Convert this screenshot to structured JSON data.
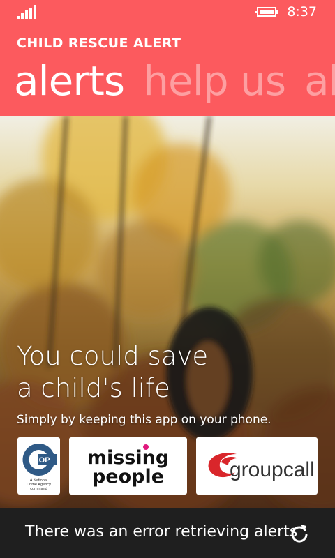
{
  "status_bar": {
    "time": "8:37",
    "signal_icon": "signal-strength-icon",
    "battery_icon": "battery-charging-icon"
  },
  "header": {
    "app_title": "CHILD RESCUE ALERT",
    "pivot_items": [
      "alerts",
      "help us",
      "ab"
    ],
    "active_index": 0,
    "background_color": "#fc5a5e"
  },
  "hero": {
    "headline_line1": "You could save",
    "headline_line2": "a child's life",
    "subline": "Simply by keeping this app on your phone."
  },
  "partners": {
    "ceop": {
      "name": "CEOP",
      "caption_line1": "A National",
      "caption_line2": "Crime Agency",
      "caption_line3": "command"
    },
    "missing_people": {
      "line1": "missing",
      "line2": "people"
    },
    "groupcall": {
      "name": "groupcall",
      "accent_color": "#d9262b"
    }
  },
  "footer": {
    "error_message": "There was an error retrieving alerts",
    "refresh_icon": "refresh-icon"
  }
}
